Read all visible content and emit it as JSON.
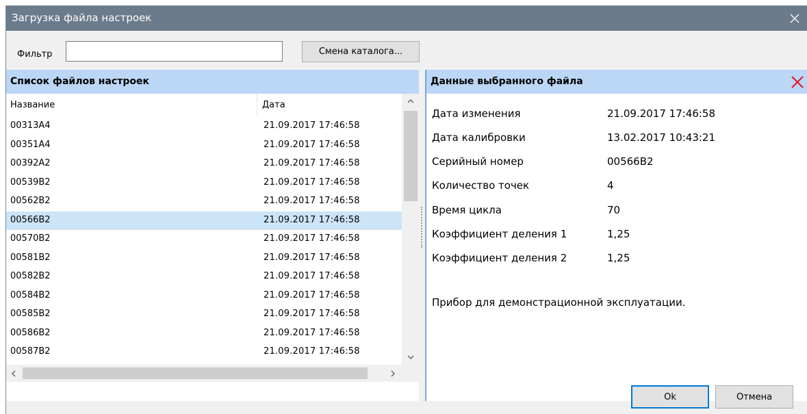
{
  "window": {
    "title": "Загрузка файла настроек"
  },
  "filter": {
    "label": "Фильтр",
    "value": "",
    "change_dir_label": "Смена каталога..."
  },
  "file_list": {
    "header": "Список файлов настроек",
    "columns": [
      "Название",
      "Дата"
    ],
    "rows": [
      {
        "name": "00313A4",
        "date": "21.09.2017 17:46:58"
      },
      {
        "name": "00351A4",
        "date": "21.09.2017 17:46:58"
      },
      {
        "name": "00392A2",
        "date": "21.09.2017 17:46:58"
      },
      {
        "name": "00539B2",
        "date": "21.09.2017 17:46:58"
      },
      {
        "name": "00562B2",
        "date": "21.09.2017 17:46:58"
      },
      {
        "name": "00566B2",
        "date": "21.09.2017 17:46:58"
      },
      {
        "name": "00570B2",
        "date": "21.09.2017 17:46:58"
      },
      {
        "name": "00581B2",
        "date": "21.09.2017 17:46:58"
      },
      {
        "name": "00582B2",
        "date": "21.09.2017 17:46:58"
      },
      {
        "name": "00584B2",
        "date": "21.09.2017 17:46:58"
      },
      {
        "name": "00585B2",
        "date": "21.09.2017 17:46:58"
      },
      {
        "name": "00586B2",
        "date": "21.09.2017 17:46:58"
      },
      {
        "name": "00587B2",
        "date": "21.09.2017 17:46:58"
      }
    ],
    "selected_index": 5
  },
  "details": {
    "header": "Данные выбранного файла",
    "items": [
      {
        "label": "Дата изменения",
        "value": "21.09.2017 17:46:58"
      },
      {
        "label": "Дата калибровки",
        "value": "13.02.2017 10:43:21"
      },
      {
        "label": "Серийный номер",
        "value": "00566B2"
      },
      {
        "label": "Количество точек",
        "value": "4"
      },
      {
        "label": "Время цикла",
        "value": "70"
      },
      {
        "label": "Коэффициент деления 1",
        "value": "1,25"
      },
      {
        "label": "Коэффициент деления 2",
        "value": "1,25"
      }
    ],
    "note": "Прибор для демонстрационной эксплуатации."
  },
  "buttons": {
    "ok": "Ok",
    "cancel": "Отмена"
  },
  "colors": {
    "titlebar": "#6c7b8c",
    "panel_header": "#bcd6f5",
    "selected_row": "#cce4f7",
    "close_red": "#e81123",
    "accent": "#0078d7"
  }
}
